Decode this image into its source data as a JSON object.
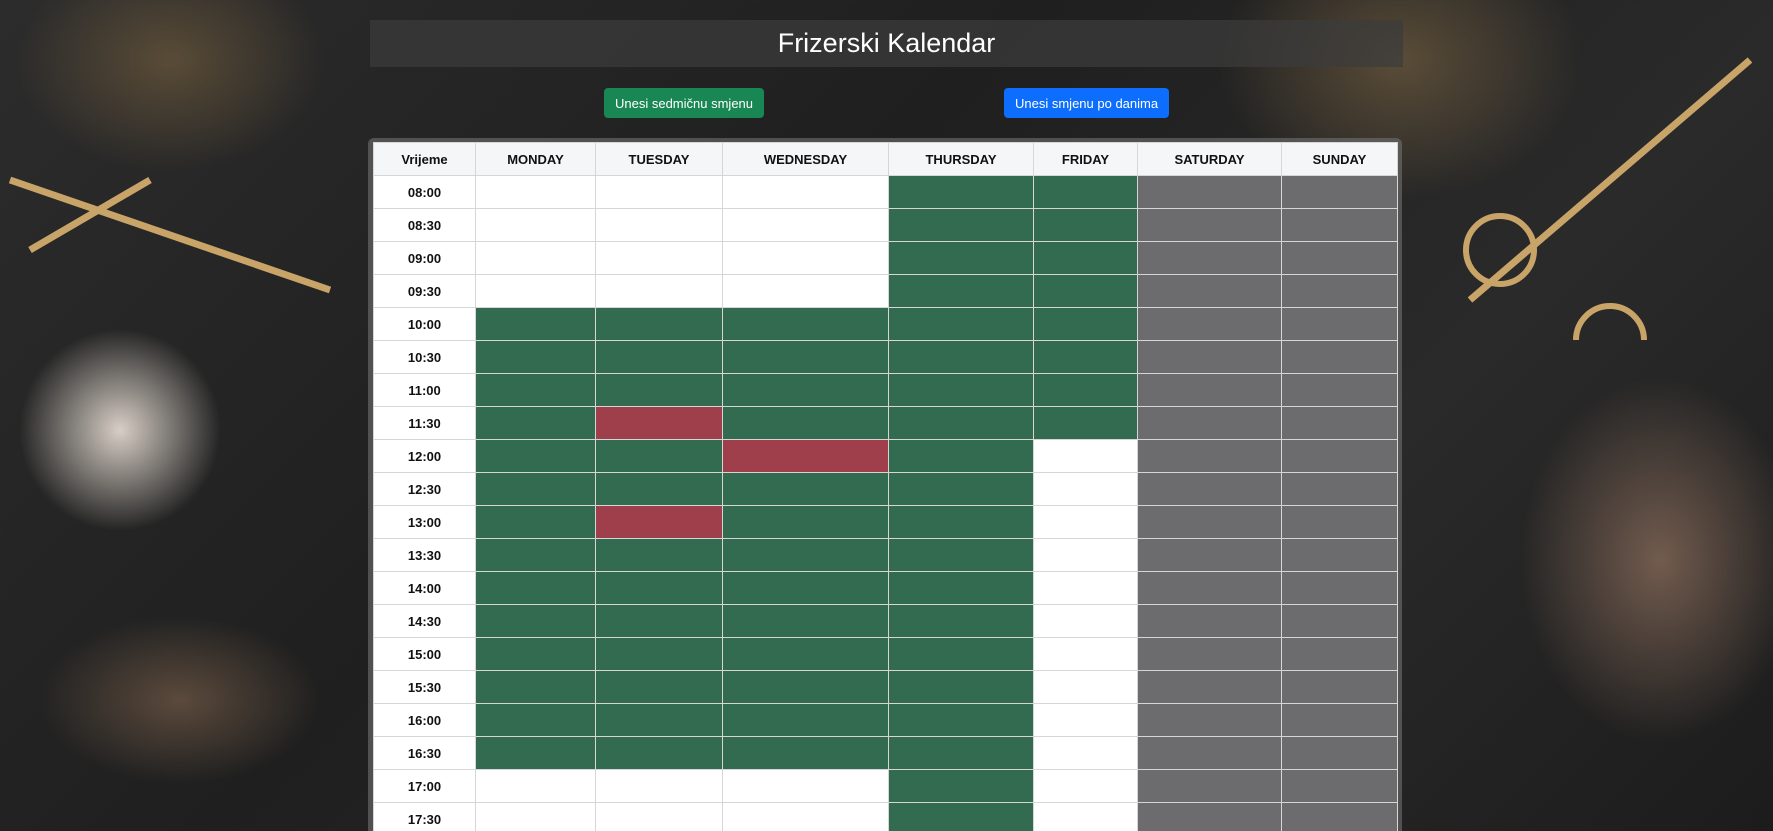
{
  "header": {
    "title": "Frizerski Kalendar"
  },
  "buttons": {
    "weekly_shift": "Unesi sedmičnu smjenu",
    "daily_shift": "Unesi smjenu po danima"
  },
  "colors": {
    "work": "#2d6e4e",
    "busy": "#aa3c4b",
    "off": "#6e6e70",
    "free": "#ffffff"
  },
  "calendar": {
    "time_header": "Vrijeme",
    "days": [
      "MONDAY",
      "TUESDAY",
      "WEDNESDAY",
      "THURSDAY",
      "FRIDAY",
      "SATURDAY",
      "SUNDAY"
    ],
    "slots": [
      {
        "time": "08:00",
        "cells": [
          "free",
          "free",
          "free",
          "work",
          "work",
          "off",
          "off"
        ]
      },
      {
        "time": "08:30",
        "cells": [
          "free",
          "free",
          "free",
          "work",
          "work",
          "off",
          "off"
        ]
      },
      {
        "time": "09:00",
        "cells": [
          "free",
          "free",
          "free",
          "work",
          "work",
          "off",
          "off"
        ]
      },
      {
        "time": "09:30",
        "cells": [
          "free",
          "free",
          "free",
          "work",
          "work",
          "off",
          "off"
        ]
      },
      {
        "time": "10:00",
        "cells": [
          "work",
          "work",
          "work",
          "work",
          "work",
          "off",
          "off"
        ]
      },
      {
        "time": "10:30",
        "cells": [
          "work",
          "work",
          "work",
          "work",
          "work",
          "off",
          "off"
        ]
      },
      {
        "time": "11:00",
        "cells": [
          "work",
          "work",
          "work",
          "work",
          "work",
          "off",
          "off"
        ]
      },
      {
        "time": "11:30",
        "cells": [
          "work",
          "busy",
          "work",
          "work",
          "work",
          "off",
          "off"
        ]
      },
      {
        "time": "12:00",
        "cells": [
          "work",
          "work",
          "busy",
          "work",
          "free",
          "off",
          "off"
        ]
      },
      {
        "time": "12:30",
        "cells": [
          "work",
          "work",
          "work",
          "work",
          "free",
          "off",
          "off"
        ]
      },
      {
        "time": "13:00",
        "cells": [
          "work",
          "busy",
          "work",
          "work",
          "free",
          "off",
          "off"
        ]
      },
      {
        "time": "13:30",
        "cells": [
          "work",
          "work",
          "work",
          "work",
          "free",
          "off",
          "off"
        ]
      },
      {
        "time": "14:00",
        "cells": [
          "work",
          "work",
          "work",
          "work",
          "free",
          "off",
          "off"
        ]
      },
      {
        "time": "14:30",
        "cells": [
          "work",
          "work",
          "work",
          "work",
          "free",
          "off",
          "off"
        ]
      },
      {
        "time": "15:00",
        "cells": [
          "work",
          "work",
          "work",
          "work",
          "free",
          "off",
          "off"
        ]
      },
      {
        "time": "15:30",
        "cells": [
          "work",
          "work",
          "work",
          "work",
          "free",
          "off",
          "off"
        ]
      },
      {
        "time": "16:00",
        "cells": [
          "work",
          "work",
          "work",
          "work",
          "free",
          "off",
          "off"
        ]
      },
      {
        "time": "16:30",
        "cells": [
          "work",
          "work",
          "work",
          "work",
          "free",
          "off",
          "off"
        ]
      },
      {
        "time": "17:00",
        "cells": [
          "free",
          "free",
          "free",
          "work",
          "free",
          "off",
          "off"
        ]
      },
      {
        "time": "17:30",
        "cells": [
          "free",
          "free",
          "free",
          "work",
          "free",
          "off",
          "off"
        ]
      }
    ]
  }
}
